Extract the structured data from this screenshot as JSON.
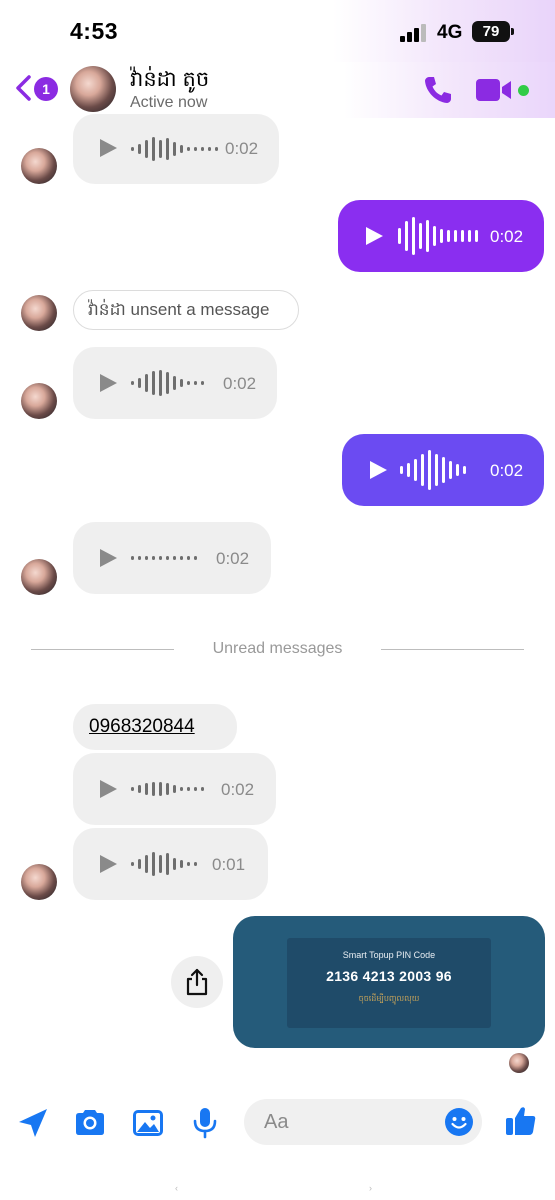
{
  "status_bar": {
    "time": "4:53",
    "network": "4G",
    "battery": "79"
  },
  "header": {
    "back_badge": "1",
    "contact_name": "វ៉ាន់ដា តូច",
    "presence": "Active now"
  },
  "messages": [
    {
      "direction": "incoming",
      "type": "voice",
      "duration": "0:02"
    },
    {
      "direction": "outgoing",
      "type": "voice",
      "duration": "0:02"
    },
    {
      "direction": "incoming",
      "type": "unsent",
      "text": "វ៉ាន់ដា unsent a message"
    },
    {
      "direction": "incoming",
      "type": "voice",
      "duration": "0:02"
    },
    {
      "direction": "outgoing",
      "type": "voice",
      "duration": "0:02"
    },
    {
      "direction": "incoming",
      "type": "voice",
      "duration": "0:02"
    }
  ],
  "unread_divider": "Unread messages",
  "new_messages": [
    {
      "direction": "incoming",
      "type": "text",
      "text": "0968320844"
    },
    {
      "direction": "incoming",
      "type": "voice",
      "duration": "0:02"
    },
    {
      "direction": "incoming",
      "type": "voice",
      "duration": "0:01"
    }
  ],
  "image_card": {
    "title": "Smart  Topup PIN Code",
    "code": "2136 4213 2003 96",
    "subtitle": "ចុចដើម្បីបញ្ចូលលុយ"
  },
  "composer": {
    "placeholder": "Aa"
  },
  "colors": {
    "accent": "#8b2be2",
    "outgoing_1": "#8a2ef0",
    "outgoing_2": "#6b4bf2",
    "composer_icons": "#1877f2",
    "card": "#255b7a"
  }
}
